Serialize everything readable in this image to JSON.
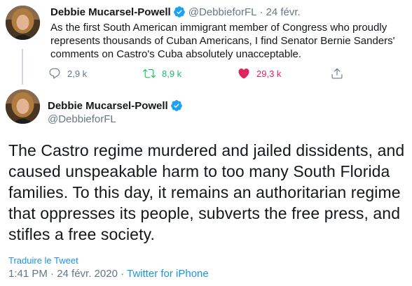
{
  "colors": {
    "accent": "#1da1f2",
    "retweet": "#17bf63",
    "like": "#e0245e",
    "muted": "#657786",
    "text": "#14171a",
    "link": "#1b95e0"
  },
  "tweet1": {
    "author_name": "Debbie Mucarsel-Powell",
    "handle": "@DebbieforFL",
    "separator": "·",
    "date": "24 févr.",
    "text": "As the first South American immigrant member of Congress who proudly represents thousands of Cuban Americans, I find Senator Bernie Sanders' comments on Castro's Cuba absolutely unacceptable.",
    "replies": "2,9 k",
    "retweets": "8,9 k",
    "likes": "29,3 k",
    "icons": {
      "reply": "reply-icon",
      "retweet": "retweet-icon",
      "like": "heart-icon",
      "share": "share-icon"
    }
  },
  "tweet2": {
    "author_name": "Debbie Mucarsel-Powell",
    "handle": "@DebbieforFL",
    "text": "The Castro regime murdered and jailed dissidents, and caused unspeakable harm to too many South Florida families. To this day, it remains an authoritarian regime that oppresses its people, subverts the free press, and stifles a free society.",
    "translate_label": "Traduire le Tweet",
    "timestamp": "1:41 PM · 24 févr. 2020",
    "meta_separator": "·",
    "source": "Twitter for iPhone"
  }
}
